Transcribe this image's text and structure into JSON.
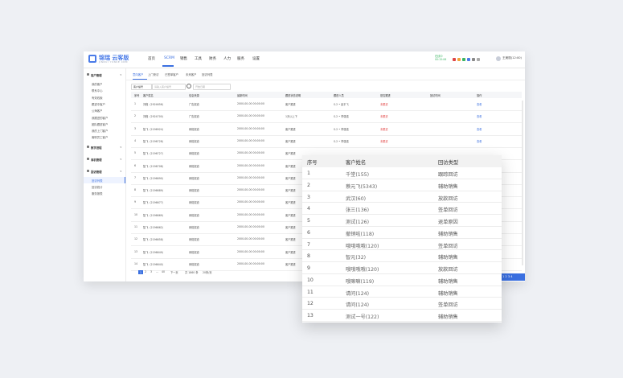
{
  "app": {
    "logo_text": "锦瑞 云客版",
    "logo_sub": "JINRUI YUNKE CRM",
    "nav": [
      {
        "label": "首页"
      },
      {
        "label": "SCRM"
      },
      {
        "label": "销售"
      },
      {
        "label": "工具"
      },
      {
        "label": "财务"
      },
      {
        "label": "人力"
      },
      {
        "label": "服务"
      },
      {
        "label": "设置"
      }
    ],
    "nav_active_index": 1,
    "online_status": "在线中",
    "online_time": "00:15:06",
    "user_name": "王美丽(12:00)",
    "icon_colors": [
      "#e04545",
      "#f2a33a",
      "#3bb463",
      "#4a7be8",
      "#888888",
      "#aaaaaa"
    ]
  },
  "sidebar": {
    "groups": [
      {
        "label": "客户管理",
        "items": [
          "我的客户",
          "联系中心",
          "有效线索",
          "跟进中客户",
          "公海客户",
          "我跟进的客户",
          "团队跟进客户",
          "我的上门客户",
          "离职员工客户"
        ]
      },
      {
        "label": "数字进程",
        "items": []
      },
      {
        "label": "商机管理",
        "items": []
      },
      {
        "label": "回访管理",
        "items": [
          "回访列表",
          "回访统计",
          "服务报表"
        ]
      }
    ],
    "active_item": "回访列表"
  },
  "content": {
    "tabs": [
      "意向客户",
      "上门来访",
      "已签单客户",
      "未来客户",
      "回访列表"
    ],
    "active_tab": 0,
    "filter_select": "客户编号",
    "filter_input_placeholder": "请输入客户编号",
    "filter_date_placeholder": "开始日期",
    "table_headers": [
      "序号",
      "客户姓名",
      "信息来源",
      "最新时间",
      "跟进状态说明",
      "跟进人员",
      "是否跟进",
      "回访时间",
      "操作"
    ],
    "rows": [
      {
        "no": "1",
        "name": "刘程（2924656）",
        "source": "广告渠道",
        "time": "2000-00-00 00:00:00",
        "status": "客户跟进",
        "staff": "S-2 • 赵平飞",
        "follow": "未跟进",
        "op": "查看"
      },
      {
        "no": "2",
        "name": "刘程（2924700）",
        "source": "广告渠道",
        "time": "2000-00-00 00:00:00",
        "status": "1天以上下",
        "staff": "S-2 • 李强强",
        "follow": "未跟进",
        "op": "查看"
      },
      {
        "no": "3",
        "name": "智飞（2196924）",
        "source": "网络渠道",
        "time": "2000-00-00 00:00:00",
        "status": "客户跟进",
        "staff": "S-2 • 李强强",
        "follow": "未跟进",
        "op": "查看"
      },
      {
        "no": "4",
        "name": "智飞（2196728）",
        "source": "网络渠道",
        "time": "2000-00-00 00:00:00",
        "status": "客户跟进",
        "staff": "S-2 • 李强强",
        "follow": "未跟进",
        "op": "查看"
      },
      {
        "no": "5",
        "name": "智飞（2196727）",
        "source": "网络渠道",
        "time": "2000-00-00 00:00:00",
        "status": "客户跟进",
        "staff": "",
        "follow": "",
        "op": ""
      },
      {
        "no": "6",
        "name": "智飞（2196708）",
        "source": "网络渠道",
        "time": "2000-00-00 00:00:00",
        "status": "客户跟进",
        "staff": "",
        "follow": "",
        "op": ""
      },
      {
        "no": "7",
        "name": "智飞（2196690）",
        "source": "网络渠道",
        "time": "2000-00-00 00:00:00",
        "status": "客户跟进",
        "staff": "",
        "follow": "",
        "op": ""
      },
      {
        "no": "8",
        "name": "智飞（2196689）",
        "source": "网络渠道",
        "time": "2000-00-00 00:00:00",
        "status": "客户跟进",
        "staff": "",
        "follow": "",
        "op": ""
      },
      {
        "no": "9",
        "name": "智飞（2196677）",
        "source": "网络渠道",
        "time": "2000-00-00 00:00:00",
        "status": "客户跟进",
        "staff": "",
        "follow": "",
        "op": ""
      },
      {
        "no": "10",
        "name": "智飞（2196669）",
        "source": "网络渠道",
        "time": "2000-00-00 00:00:00",
        "status": "客户跟进",
        "staff": "",
        "follow": "",
        "op": ""
      },
      {
        "no": "11",
        "name": "智飞（2196662）",
        "source": "网络渠道",
        "time": "2000-00-00 00:00:00",
        "status": "客户跟进",
        "staff": "",
        "follow": "",
        "op": ""
      },
      {
        "no": "12",
        "name": "智飞（2196658）",
        "source": "网络渠道",
        "time": "2000-00-00 00:00:00",
        "status": "客户跟进",
        "staff": "",
        "follow": "",
        "op": ""
      },
      {
        "no": "13",
        "name": "智飞（2196649）",
        "source": "网络渠道",
        "time": "2000-00-00 00:00:00",
        "status": "客户跟进",
        "staff": "",
        "follow": "",
        "op": ""
      },
      {
        "no": "14",
        "name": "智飞（2196640）",
        "source": "网络渠道",
        "time": "2000-00-00 00:00:00",
        "status": "客户跟进",
        "staff": "",
        "follow": "",
        "op": ""
      }
    ],
    "pagination": [
      "1",
      "2",
      "3",
      "...",
      "40",
      "下一页",
      "共 1860 条",
      "20条/页"
    ],
    "overflow_pager": "1 2 3 4"
  },
  "zoom_panel": {
    "headers": [
      "序号",
      "客户姓名",
      "回访类型"
    ],
    "rows": [
      {
        "no": "1",
        "name": "千堂(155)",
        "type": "跟踪回访"
      },
      {
        "no": "2",
        "name": "蔡元飞(5343)",
        "type": "辅助销售"
      },
      {
        "no": "3",
        "name": "武汉(60)",
        "type": "放款回访"
      },
      {
        "no": "4",
        "name": "张三(136)",
        "type": "签单回访"
      },
      {
        "no": "5",
        "name": "测试(126)",
        "type": "退单原因"
      },
      {
        "no": "6",
        "name": "撤销啦(118)",
        "type": "辅助销售"
      },
      {
        "no": "7",
        "name": "哦哦哦哦(120)",
        "type": "签单回访"
      },
      {
        "no": "8",
        "name": "智元(32)",
        "type": "辅助销售"
      },
      {
        "no": "9",
        "name": "哦哦哦哦(120)",
        "type": "放款回访"
      },
      {
        "no": "10",
        "name": "哦嘛嘛(119)",
        "type": "辅助销售"
      },
      {
        "no": "11",
        "name": "请问(124)",
        "type": "辅助销售"
      },
      {
        "no": "12",
        "name": "请问(124)",
        "type": "签单回访"
      },
      {
        "no": "13",
        "name": "测试一号(122)",
        "type": "辅助销售"
      }
    ]
  }
}
